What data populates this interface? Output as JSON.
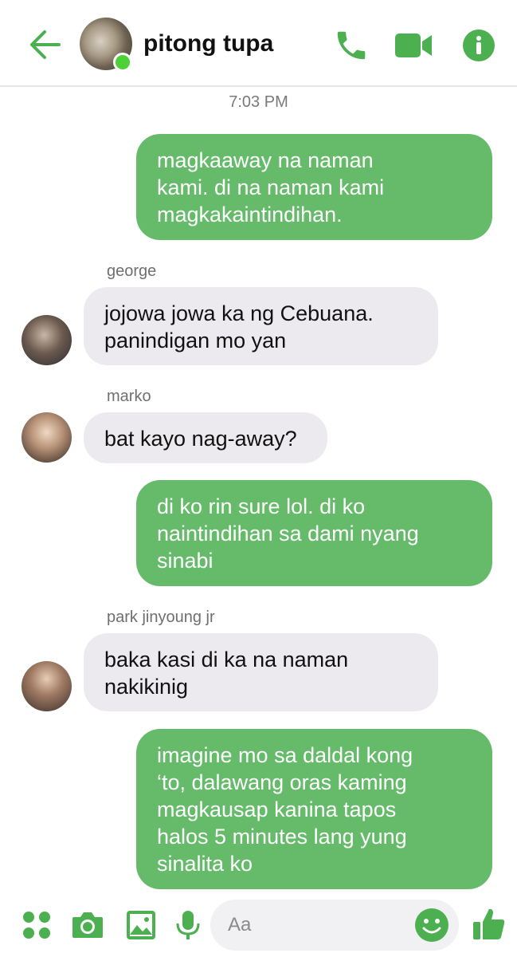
{
  "header": {
    "contact_name": "pitong tupa",
    "online": true,
    "accent_color": "#4caf50",
    "icons": [
      "back-arrow-icon",
      "phone-icon",
      "video-camera-icon",
      "info-icon"
    ]
  },
  "timestamp": "7:03 PM",
  "messages": [
    {
      "direction": "outgoing",
      "lines": [
        "magkaaway na naman",
        "kami. di na naman kami",
        "magkakaintindihan."
      ]
    },
    {
      "direction": "incoming",
      "sender": "george",
      "lines": [
        "jojowa jowa ka ng Cebuana.",
        "panindigan mo yan"
      ]
    },
    {
      "direction": "incoming",
      "sender": "marko",
      "lines": [
        "bat kayo nag-away?"
      ]
    },
    {
      "direction": "outgoing",
      "lines": [
        "di ko rin sure lol. di ko",
        "naintindihan sa dami nyang",
        "sinabi"
      ]
    },
    {
      "direction": "incoming",
      "sender": "park jinyoung jr",
      "lines": [
        "baka kasi di ka na naman",
        "nakikinig"
      ]
    },
    {
      "direction": "outgoing",
      "lines": [
        "imagine mo sa daldal kong",
        "‘to, dalawang oras kaming",
        "magkausap kanina tapos",
        "halos 5 minutes lang yung",
        "sinalita ko"
      ]
    }
  ],
  "composer": {
    "placeholder": "Aa",
    "icons": [
      "menu-dots-icon",
      "camera-icon",
      "image-icon",
      "microphone-icon",
      "emoji-icon",
      "thumbs-up-icon"
    ]
  },
  "colors": {
    "outgoing_bubble": "#66bb6a",
    "incoming_bubble": "#eceaee"
  }
}
